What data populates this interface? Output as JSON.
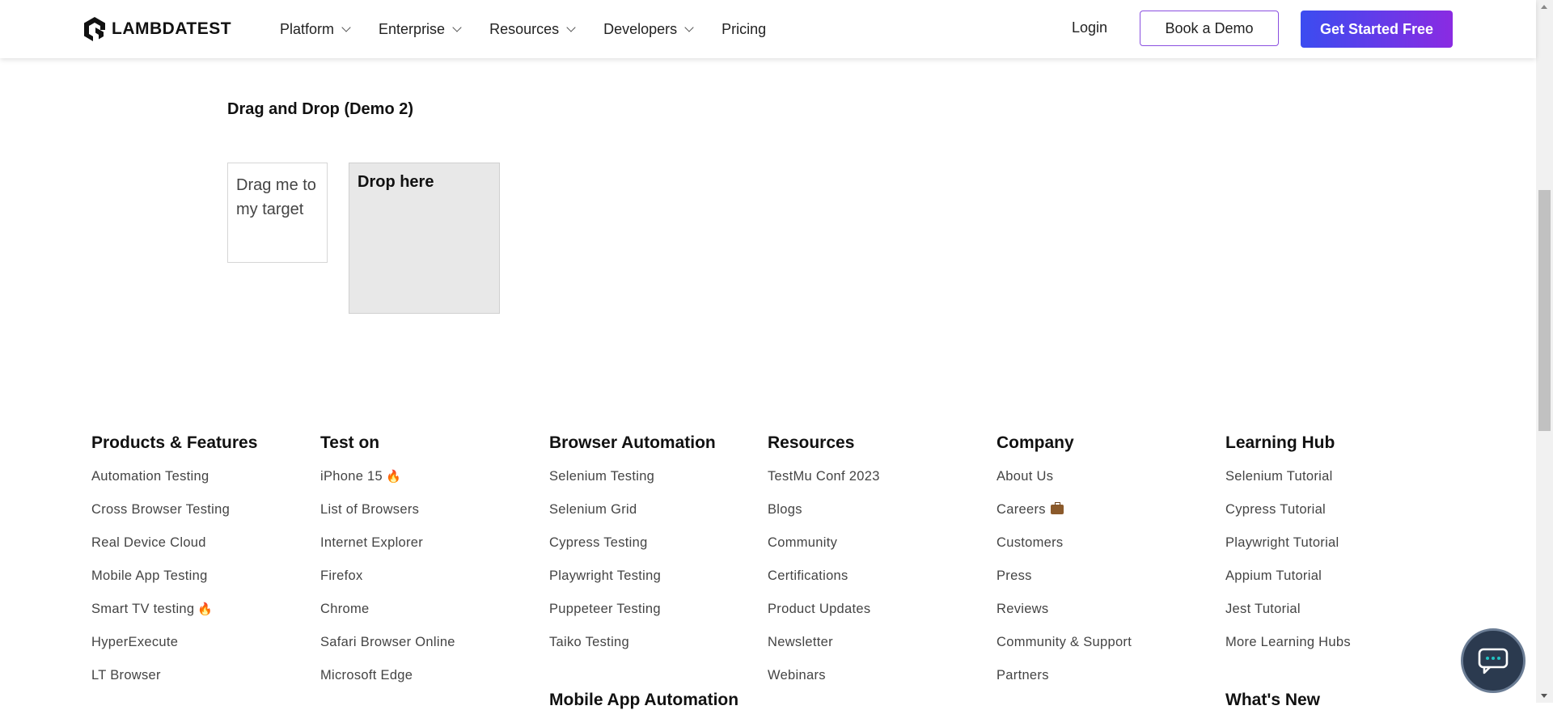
{
  "header": {
    "logo_text": "LAMBDATEST",
    "nav": [
      {
        "label": "Platform",
        "has_dropdown": true
      },
      {
        "label": "Enterprise",
        "has_dropdown": true
      },
      {
        "label": "Resources",
        "has_dropdown": true
      },
      {
        "label": "Developers",
        "has_dropdown": true
      },
      {
        "label": "Pricing",
        "has_dropdown": false
      }
    ],
    "login_label": "Login",
    "book_demo_label": "Book a Demo",
    "get_started_label": "Get Started Free"
  },
  "demo": {
    "title": "Drag and Drop (Demo 2)",
    "drag_text": "Drag me to my target",
    "drop_text": "Drop here"
  },
  "footer": {
    "columns": [
      {
        "heading": "Products & Features",
        "items": [
          "Automation Testing",
          "Cross Browser Testing",
          "Real Device Cloud",
          "Mobile App Testing",
          "Smart TV testing",
          "HyperExecute",
          "LT Browser"
        ]
      },
      {
        "heading": "Test on",
        "items": [
          "iPhone 15",
          "List of Browsers",
          "Internet Explorer",
          "Firefox",
          "Chrome",
          "Safari Browser Online",
          "Microsoft Edge"
        ]
      },
      {
        "heading": "Browser Automation",
        "items": [
          "Selenium Testing",
          "Selenium Grid",
          "Cypress Testing",
          "Playwright Testing",
          "Puppeteer Testing",
          "Taiko Testing"
        ],
        "sub_heading": "Mobile App Automation"
      },
      {
        "heading": "Resources",
        "items": [
          "TestMu Conf 2023",
          "Blogs",
          "Community",
          "Certifications",
          "Product Updates",
          "Newsletter",
          "Webinars"
        ]
      },
      {
        "heading": "Company",
        "items": [
          "About Us",
          "Careers",
          "Customers",
          "Press",
          "Reviews",
          "Community & Support",
          "Partners"
        ]
      },
      {
        "heading": "Learning Hub",
        "items": [
          "Selenium Tutorial",
          "Cypress Tutorial",
          "Playwright Tutorial",
          "Appium Tutorial",
          "Jest Tutorial",
          "More Learning Hubs"
        ],
        "sub_heading": "What's New"
      }
    ],
    "emoji_tags": {
      "fire": "🔥"
    }
  },
  "icons": {
    "chat": "chat-bubble-icon",
    "dropdown": "chevron-down-icon"
  },
  "colors": {
    "brand_gradient_start": "#3b4cf0",
    "brand_gradient_end": "#8a2be2",
    "demo_border": "#8a4fe0",
    "chat_bg": "#2b3a4f"
  }
}
